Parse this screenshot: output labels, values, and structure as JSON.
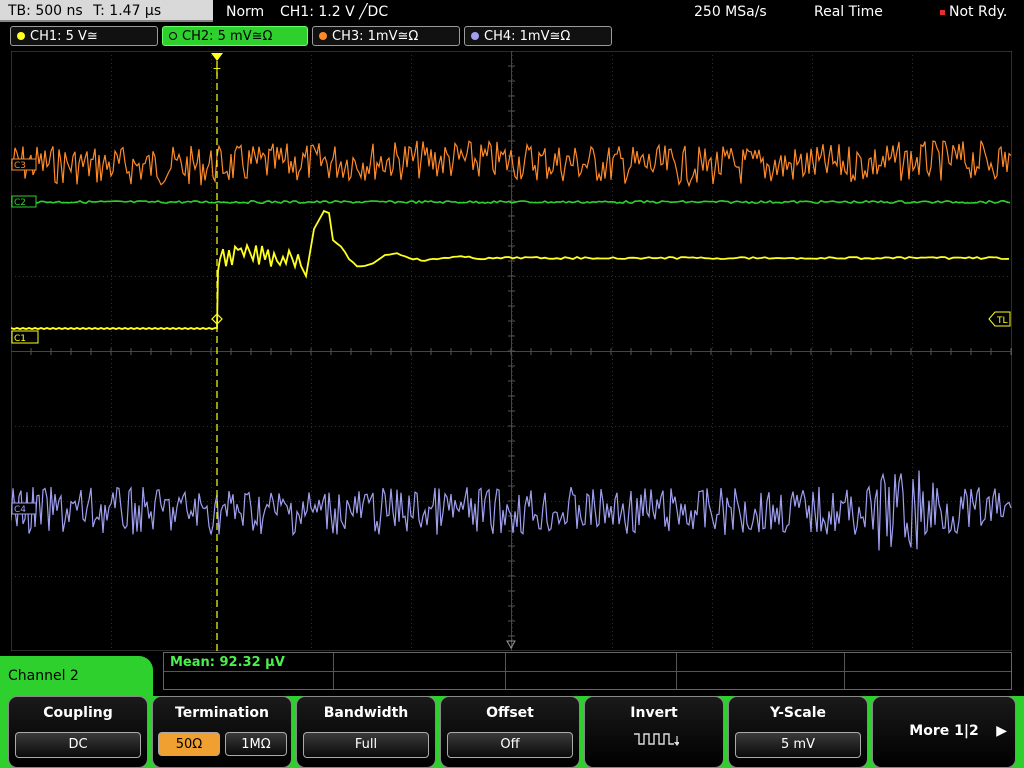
{
  "status": {
    "timebase": "TB: 500 ns",
    "trigger_time": "T: 1.47 µs",
    "trigger_mode": "Norm",
    "trigger_setting": "CH1: 1.2 V ╱DC",
    "sample_rate": "250 MSa/s",
    "acq_mode": "Real Time",
    "ready_state": "Not Rdy."
  },
  "channels": [
    {
      "label": "CH1: 5 V≅",
      "color": "#ffff20"
    },
    {
      "label": "CH2: 5 mV≅Ω",
      "color": "#2ed02e"
    },
    {
      "label": "CH3: 1mV≅Ω",
      "color": "#ff8a2a"
    },
    {
      "label": "CH4: 1mV≅Ω",
      "color": "#9f9ff0"
    }
  ],
  "markers": {
    "c1": "C1",
    "c2": "C2",
    "c3": "C3",
    "c4": "C4",
    "tl": "TL",
    "trigger": "T"
  },
  "menu": {
    "channel_title": "Channel 2",
    "measurement": "Mean: 92.32 µV",
    "coupling_title": "Coupling",
    "coupling_value": "DC",
    "termination_title": "Termination",
    "term_50": "50Ω",
    "term_1m": "1MΩ",
    "bandwidth_title": "Bandwidth",
    "bandwidth_value": "Full",
    "offset_title": "Offset",
    "offset_value": "Off",
    "invert_title": "Invert",
    "yscale_title": "Y-Scale",
    "yscale_value": "5 mV",
    "more_label": "More 1|2"
  }
}
